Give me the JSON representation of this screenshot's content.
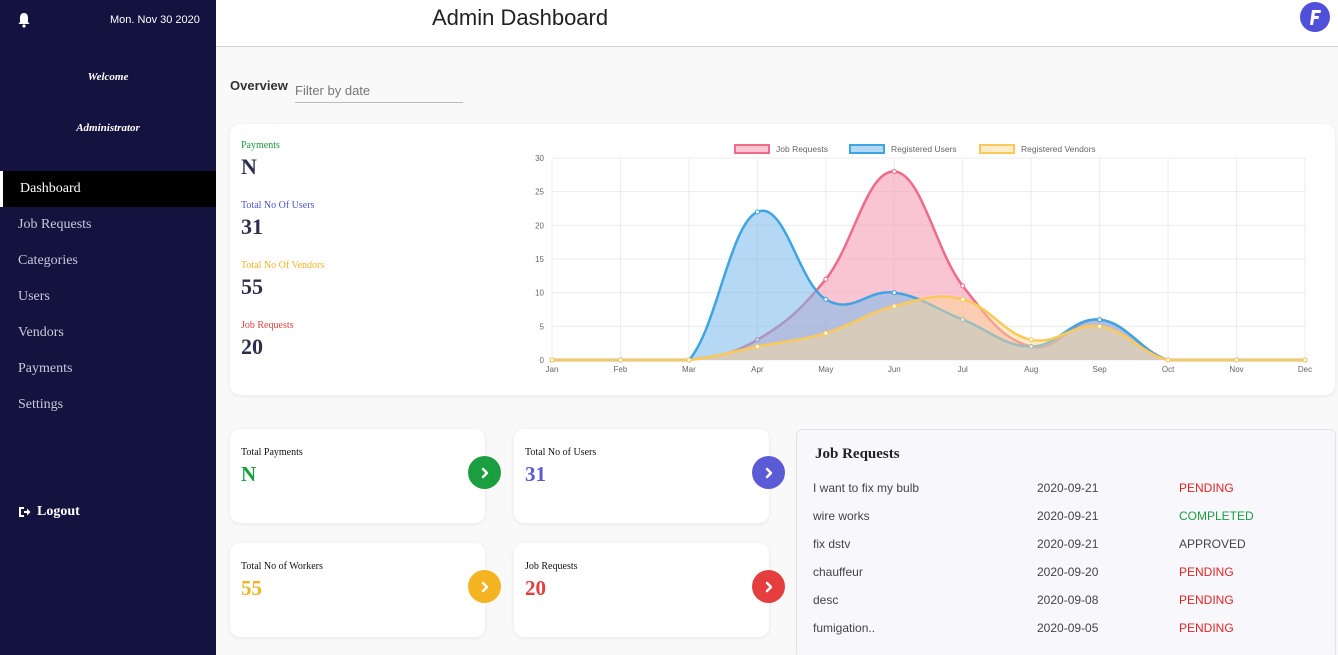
{
  "sidebar": {
    "date": "Mon. Nov 30 2020",
    "welcome": "Welcome",
    "user": "Administrator",
    "items": [
      {
        "label": "Dashboard",
        "active": true
      },
      {
        "label": "Job Requests"
      },
      {
        "label": "Categories"
      },
      {
        "label": "Users"
      },
      {
        "label": "Vendors"
      },
      {
        "label": "Payments"
      },
      {
        "label": "Settings"
      }
    ],
    "logout": "Logout",
    "background": "#14123f"
  },
  "header": {
    "title": "Admin Dashboard",
    "logo_color": "#4f4fd9"
  },
  "overview": {
    "label": "Overview",
    "filter_placeholder": "Filter by date"
  },
  "stats": [
    {
      "label": "Payments",
      "value": "N",
      "color": "#1a9e3f"
    },
    {
      "label": "Total No Of Users",
      "value": "31",
      "color": "#4a57c9"
    },
    {
      "label": "Total No Of Vendors",
      "value": "55",
      "color": "#f4b320"
    },
    {
      "label": "Job Requests",
      "value": "20",
      "color": "#e53e3e"
    }
  ],
  "chart_data": {
    "type": "area",
    "categories": [
      "Jan",
      "Feb",
      "Mar",
      "Apr",
      "May",
      "Jun",
      "Jul",
      "Aug",
      "Sep",
      "Oct",
      "Nov",
      "Dec"
    ],
    "ylim": [
      0,
      30
    ],
    "yticks": [
      0,
      5,
      10,
      15,
      20,
      25,
      30
    ],
    "legend_position": "top",
    "grid": true,
    "series": [
      {
        "name": "Job Requests",
        "values": [
          0,
          0,
          0,
          3,
          12,
          28,
          11,
          2,
          6,
          0,
          0,
          0
        ],
        "color": "#f06a8a",
        "fill": "rgba(246,150,175,0.55)"
      },
      {
        "name": "Registered Users",
        "values": [
          0,
          0,
          0,
          22,
          9,
          10,
          6,
          2,
          6,
          0,
          0,
          0
        ],
        "color": "#3fa4e2",
        "fill": "rgba(120,185,235,0.55)"
      },
      {
        "name": "Registered Vendors",
        "values": [
          0,
          0,
          0,
          2,
          4,
          8,
          9,
          3,
          5,
          0,
          0,
          0
        ],
        "color": "#fbc957",
        "fill": "rgba(252,215,150,0.5)"
      }
    ]
  },
  "cards": [
    {
      "label": "Total Payments",
      "value": "N",
      "color": "#1a9e3f"
    },
    {
      "label": "Total No of Users",
      "value": "31",
      "color": "#5b5bd6"
    },
    {
      "label": "Total No of Workers",
      "value": "55",
      "color": "#f4b320"
    },
    {
      "label": "Job Requests",
      "value": "20",
      "color": "#e53e3e"
    }
  ],
  "jobs": {
    "title": "Job Requests",
    "rows": [
      {
        "desc": "I want to fix my bulb",
        "date": "2020-09-21",
        "status": "PENDING",
        "color": "#e02424"
      },
      {
        "desc": "wire works",
        "date": "2020-09-21",
        "status": "COMPLETED",
        "color": "#1a9e3f"
      },
      {
        "desc": "fix dstv",
        "date": "2020-09-21",
        "status": "APPROVED",
        "color": "#444444"
      },
      {
        "desc": "chauffeur",
        "date": "2020-09-20",
        "status": "PENDING",
        "color": "#e02424"
      },
      {
        "desc": "desc",
        "date": "2020-09-08",
        "status": "PENDING",
        "color": "#e02424"
      },
      {
        "desc": "fumigation..",
        "date": "2020-09-05",
        "status": "PENDING",
        "color": "#e02424"
      }
    ]
  }
}
